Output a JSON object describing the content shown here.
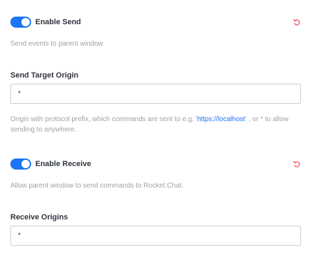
{
  "send": {
    "toggle_label": "Enable Send",
    "enabled": true,
    "hint": "Send events to parent window"
  },
  "target_origin": {
    "label": "Send Target Origin",
    "value": "*",
    "hint_before": "Origin with protocol prefix, which commands are sent to e.g. '",
    "hint_link": "https://localhost",
    "hint_after": "' , or * to allow sending to anywhere."
  },
  "receive": {
    "toggle_label": "Enable Receive",
    "enabled": true,
    "hint": "Allow parent window to send commands to Rocket.Chat."
  },
  "receive_origins": {
    "label": "Receive Origins",
    "value": "*"
  },
  "colors": {
    "accent": "#1d74f5",
    "reset": "#f5455c",
    "hint_text": "#9ea2a8"
  },
  "icons": {
    "reset": "undo-icon"
  }
}
